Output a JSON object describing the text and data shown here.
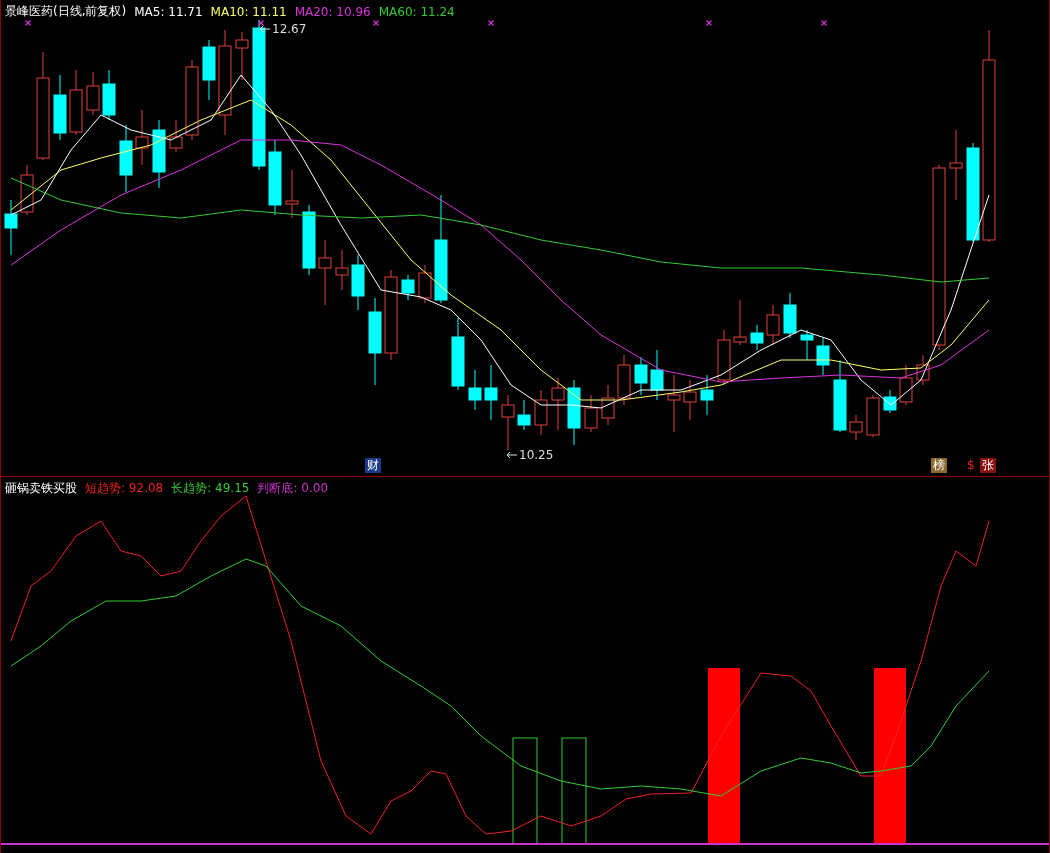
{
  "price_panel": {
    "title": "景峰医药(日线,前复权)",
    "indicators": [
      {
        "label": "MA5: 11.71",
        "color": "#ffffff"
      },
      {
        "label": "MA10: 11.11",
        "color": "#ffff66"
      },
      {
        "label": "MA20: 10.96",
        "color": "#dd33dd"
      },
      {
        "label": "MA60: 11.24",
        "color": "#33cc33"
      }
    ],
    "annotations": [
      {
        "text": "12.67",
        "kind": "high"
      },
      {
        "text": "10.25",
        "kind": "low"
      }
    ],
    "markers": [
      {
        "text": "财",
        "kind": "finance"
      },
      {
        "text": "榜",
        "kind": "rank"
      },
      {
        "text": "$",
        "kind": "dollar"
      },
      {
        "text": "张",
        "kind": "limit"
      }
    ]
  },
  "indicator_panel": {
    "title": "砸锅卖铁买股",
    "readings": [
      {
        "label": "短趋势: 92.08",
        "color": "#ee2222"
      },
      {
        "label": "长趋势: 49.15",
        "color": "#33cc33"
      },
      {
        "label": "判断底: 0.00",
        "color": "#cc33cc"
      }
    ]
  }
}
